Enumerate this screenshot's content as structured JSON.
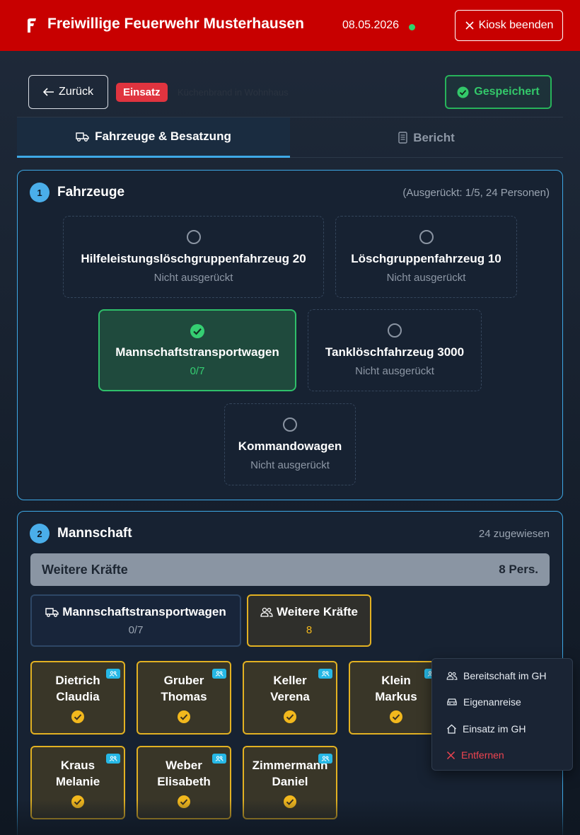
{
  "header": {
    "title": "Freiwillige Feuerwehr Musterhausen",
    "date": "08.05.2026",
    "kiosk_label": "Kiosk beenden",
    "colors": {
      "bar": "#c80000",
      "online": "#2fd36b"
    }
  },
  "actions": {
    "back_label": "Zurück",
    "badge": "Einsatz",
    "description": "Küchenbrand in Wohnhaus",
    "saved_label": "Gespeichert"
  },
  "tabs": [
    {
      "label": "Fahrzeuge & Besatzung",
      "icon": "truck-icon",
      "active": true
    },
    {
      "label": "Bericht",
      "icon": "document-icon",
      "active": false
    }
  ],
  "vehicles_section": {
    "step": "1",
    "title": "Fahrzeuge",
    "meta": "(Ausgerückt: 1/5, 24 Personen)",
    "vehicles": [
      {
        "name": "Hilfeleistungslöschgruppenfahrzeug 20",
        "status": "Nicht ausgerückt",
        "selected": false
      },
      {
        "name": "Löschgruppenfahrzeug 10",
        "status": "Nicht ausgerückt",
        "selected": false
      },
      {
        "name": "Mannschaftstransportwagen",
        "status": "0/7",
        "selected": true
      },
      {
        "name": "Tanklöschfahrzeug 3000",
        "status": "Nicht ausgerückt",
        "selected": false
      },
      {
        "name": "Kommandowagen",
        "status": "Nicht ausgerückt",
        "selected": false
      }
    ]
  },
  "crew_section": {
    "step": "2",
    "title": "Mannschaft",
    "meta": "24 zugewiesen",
    "group": {
      "title": "Weitere Kräfte",
      "count": "8 Pers."
    },
    "assignments": [
      {
        "name": "Mannschaftstransportwagen",
        "count": "0/7",
        "icon": "truck-icon"
      },
      {
        "name": "Weitere Kräfte",
        "count": "8",
        "icon": "group-icon"
      }
    ],
    "persons": [
      {
        "last": "Dietrich",
        "first": "Claudia"
      },
      {
        "last": "Gruber",
        "first": "Thomas"
      },
      {
        "last": "Keller",
        "first": "Verena"
      },
      {
        "last": "Klein",
        "first": "Markus"
      },
      {
        "last": "Kraus",
        "first": "Melanie"
      },
      {
        "last": "Weber",
        "first": "Elisabeth"
      },
      {
        "last": "Zimmermann",
        "first": "Daniel"
      }
    ]
  },
  "context_menu": {
    "items": [
      {
        "label": "Bereitschaft im GH",
        "icon": "group-icon"
      },
      {
        "label": "Eigenanreise",
        "icon": "car-icon"
      },
      {
        "label": "Einsatz im GH",
        "icon": "home-icon"
      },
      {
        "label": "Entfernen",
        "icon": "close-icon",
        "danger": true
      }
    ]
  }
}
